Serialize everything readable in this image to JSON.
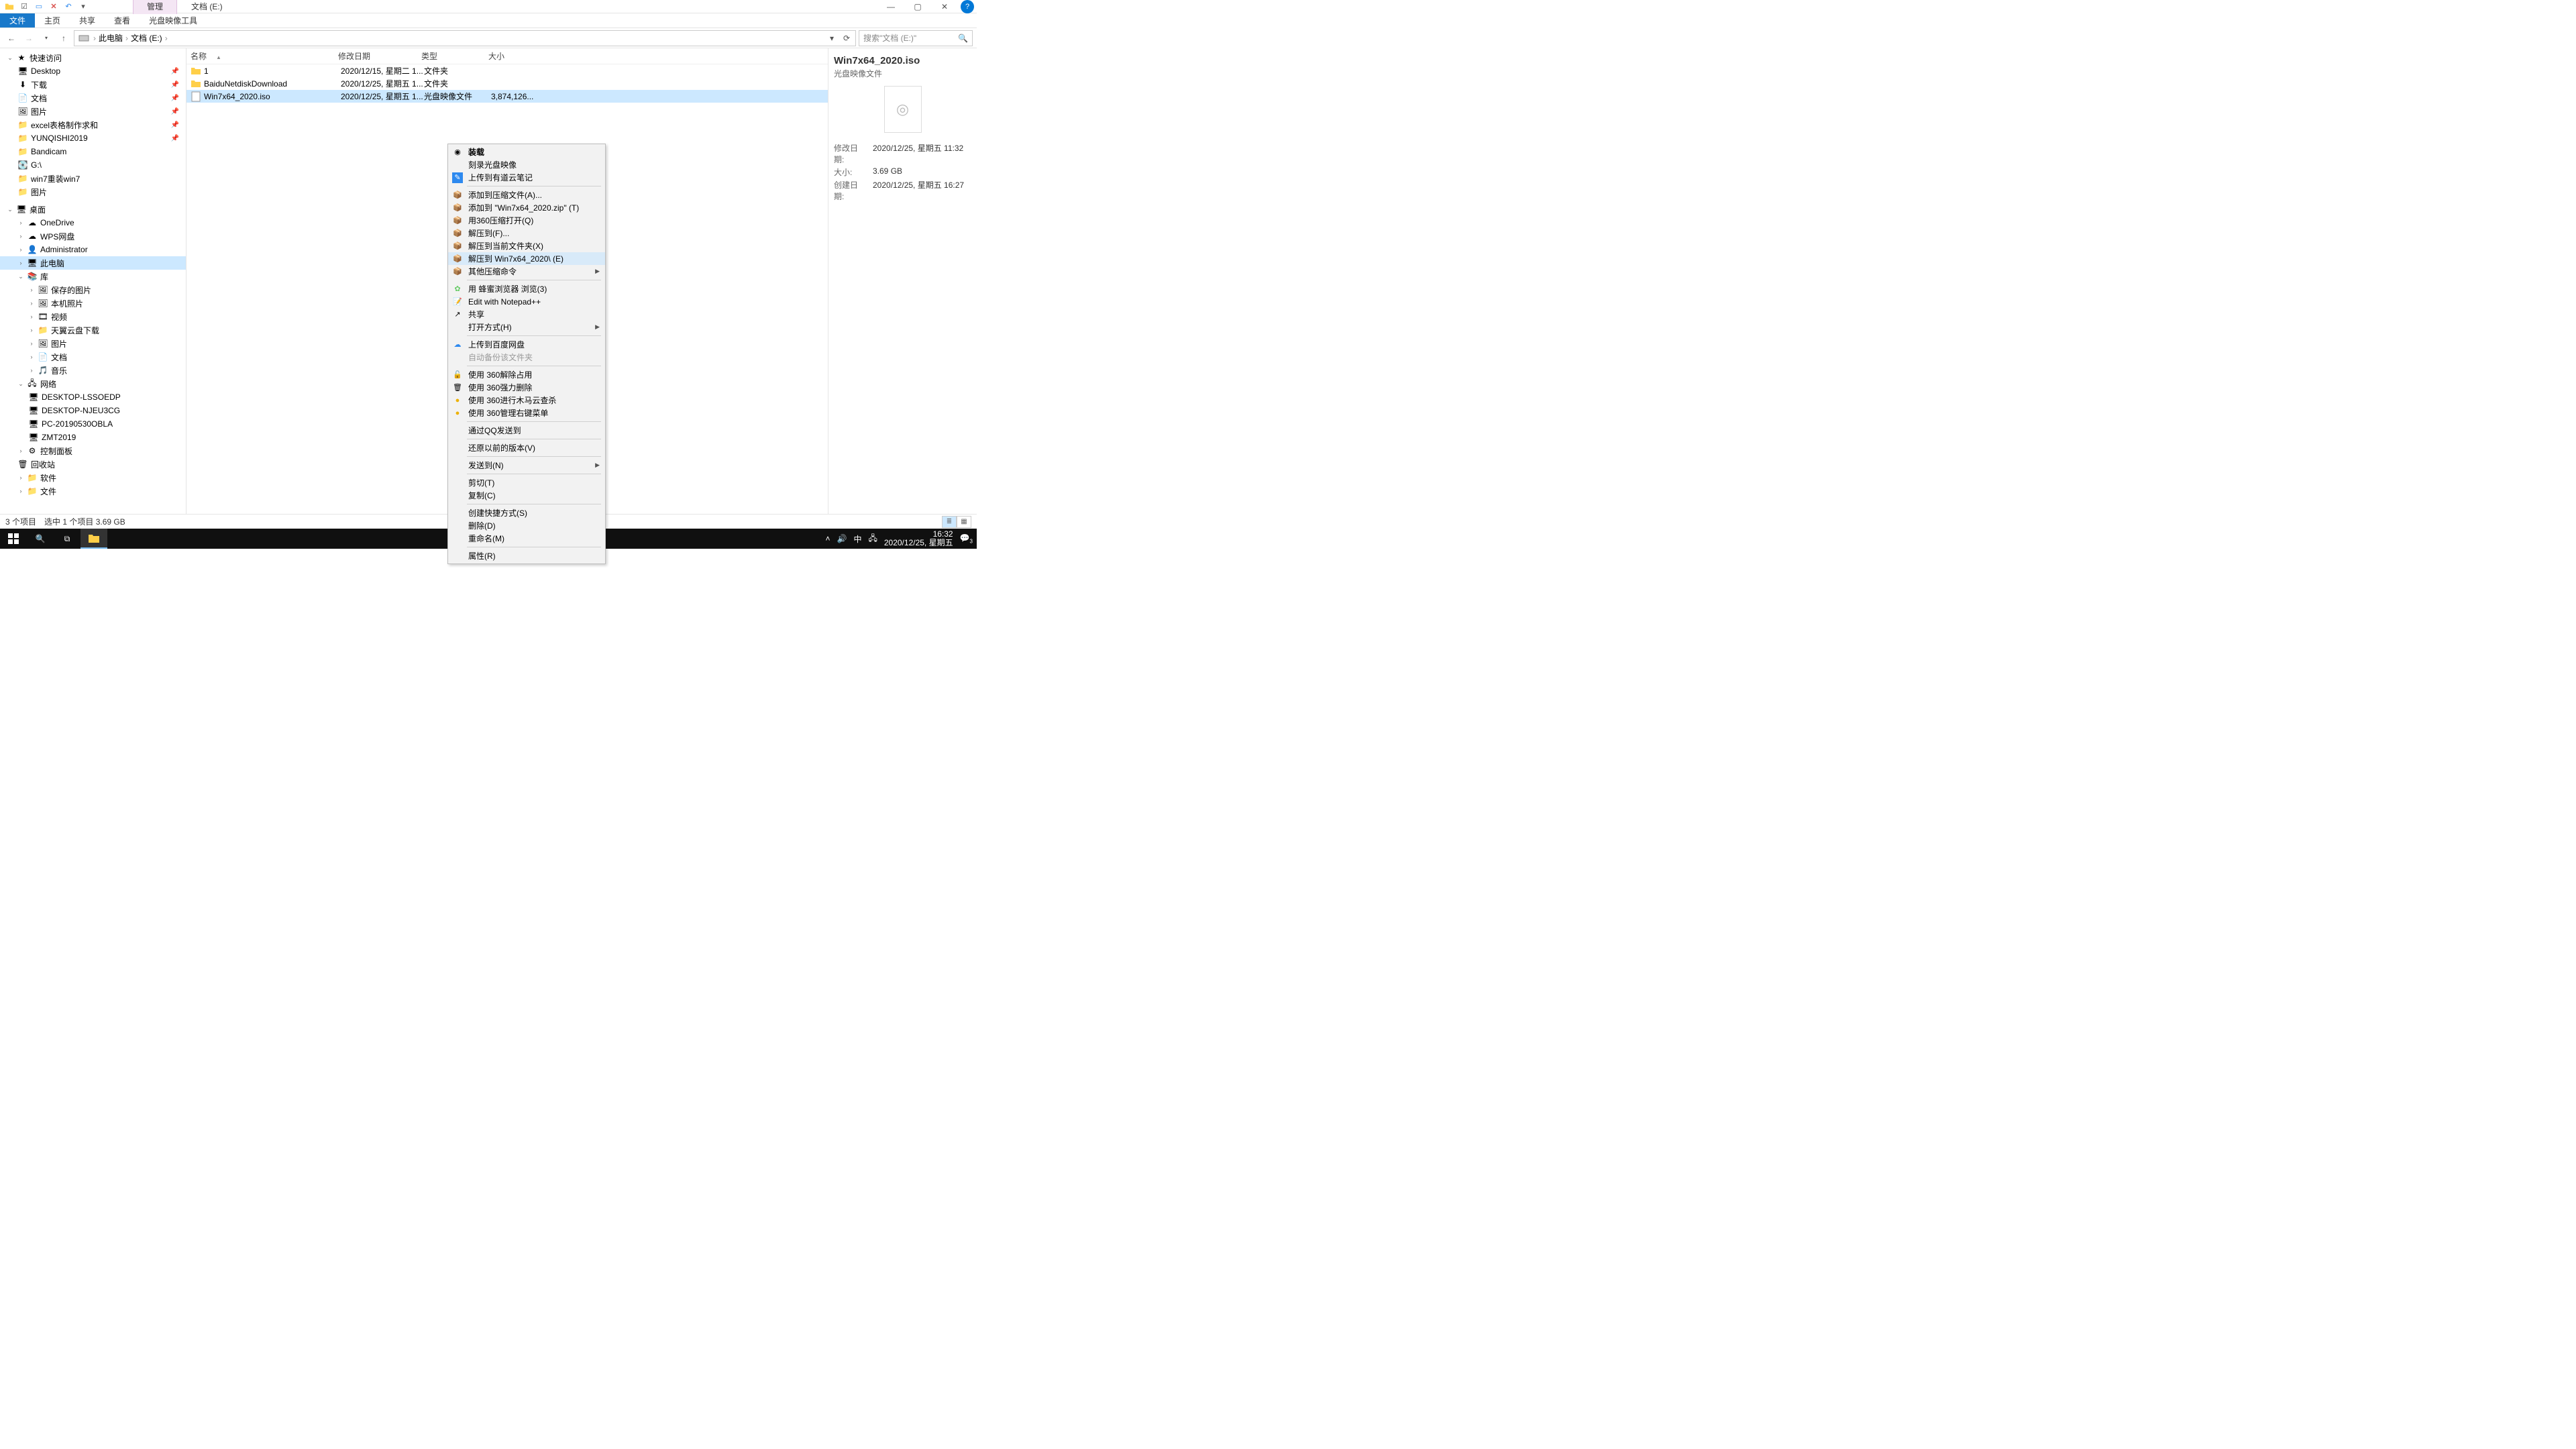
{
  "title_tabs": {
    "manage": "管理",
    "location": "文档 (E:)"
  },
  "ribbon": {
    "file": "文件",
    "home": "主页",
    "share": "共享",
    "view": "查看",
    "disc": "光盘映像工具"
  },
  "breadcrumb": {
    "pc": "此电脑",
    "drive": "文档 (E:)"
  },
  "search_placeholder": "搜索\"文档 (E:)\"",
  "tree": {
    "quick": "快速访问",
    "desktop": "Desktop",
    "downloads": "下载",
    "documents": "文档",
    "pictures": "图片",
    "excel": "excel表格制作求和",
    "yunqishi": "YUNQISHI2019",
    "bandicam": "Bandicam",
    "gdrive": "G:\\",
    "win7rw": "win7重装win7",
    "pictures2": "图片",
    "desktop_root": "桌面",
    "onedrive": "OneDrive",
    "wps": "WPS网盘",
    "admin": "Administrator",
    "thispc": "此电脑",
    "lib": "库",
    "saved_pic": "保存的图片",
    "cam_roll": "本机照片",
    "videos": "视频",
    "tianyi": "天翼云盘下载",
    "pictures3": "图片",
    "docs2": "文档",
    "music": "音乐",
    "network": "网络",
    "d_lsso": "DESKTOP-LSSOEDP",
    "d_njeu": "DESKTOP-NJEU3CG",
    "pc2019": "PC-20190530OBLA",
    "zmt": "ZMT2019",
    "ctrl": "控制面板",
    "recycle": "回收站",
    "soft": "软件",
    "files": "文件"
  },
  "columns": {
    "name": "名称",
    "date": "修改日期",
    "type": "类型",
    "size": "大小"
  },
  "rows": [
    {
      "name": "1",
      "date": "2020/12/15, 星期二 1...",
      "type": "文件夹",
      "size": ""
    },
    {
      "name": "BaiduNetdiskDownload",
      "date": "2020/12/25, 星期五 1...",
      "type": "文件夹",
      "size": ""
    },
    {
      "name": "Win7x64_2020.iso",
      "date": "2020/12/25, 星期五 1...",
      "type": "光盘映像文件",
      "size": "3,874,126..."
    }
  ],
  "ctx": {
    "mount": "装载",
    "burn": "刻录光盘映像",
    "youdao": "上传到有道云笔记",
    "add_arch": "添加到压缩文件(A)...",
    "add_zip": "添加到 \"Win7x64_2020.zip\" (T)",
    "open360": "用360压缩打开(Q)",
    "extractF": "解压到(F)...",
    "extractHere": "解压到当前文件夹(X)",
    "extractNamed": "解压到 Win7x64_2020\\ (E)",
    "otherArch": "其他压缩命令",
    "bee": "用 蜂蜜浏览器 浏览(3)",
    "npp": "Edit with Notepad++",
    "share": "共享",
    "openWith": "打开方式(H)",
    "baidu": "上传到百度网盘",
    "autobak": "自动备份该文件夹",
    "p360a": "使用 360解除占用",
    "p360b": "使用 360强力删除",
    "p360c": "使用 360进行木马云查杀",
    "p360d": "使用 360管理右键菜单",
    "qq": "通过QQ发送到",
    "restore": "还原以前的版本(V)",
    "sendto": "发送到(N)",
    "cut": "剪切(T)",
    "copy": "复制(C)",
    "shortcut": "创建快捷方式(S)",
    "delete": "删除(D)",
    "rename": "重命名(M)",
    "props": "属性(R)"
  },
  "details": {
    "name": "Win7x64_2020.iso",
    "type": "光盘映像文件",
    "k_mod": "修改日期:",
    "v_mod": "2020/12/25, 星期五 11:32",
    "k_size": "大小:",
    "v_size": "3.69 GB",
    "k_created": "创建日期:",
    "v_created": "2020/12/25, 星期五 16:27"
  },
  "status": {
    "count": "3 个项目",
    "sel": "选中 1 个项目  3.69 GB"
  },
  "tray": {
    "ime": "中",
    "time": "16:32",
    "date": "2020/12/25, 星期五",
    "badge": "3"
  }
}
